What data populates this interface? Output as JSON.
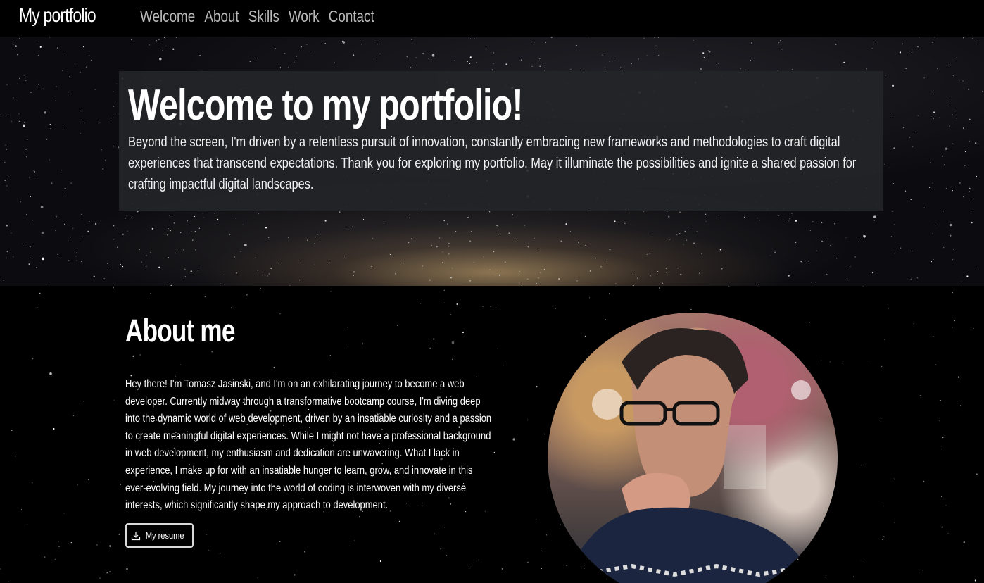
{
  "navbar": {
    "brand": "My portfolio",
    "links": [
      "Welcome",
      "About",
      "Skills",
      "Work",
      "Contact"
    ]
  },
  "hero": {
    "title": "Welcome to my portfolio!",
    "text": "Beyond the screen, I'm driven by a relentless pursuit of innovation, constantly embracing new frameworks and methodologies to craft digital experiences that transcend expectations. Thank you for exploring my portfolio. May it illuminate the possibilities and ignite a shared passion for crafting impactful digital landscapes."
  },
  "about": {
    "title": "About me",
    "text": "Hey there! I'm Tomasz Jasinski, and I'm on an exhilarating journey to become a web developer. Currently midway through a transformative bootcamp course, I'm diving deep into the dynamic world of web development, driven by an insatiable curiosity and a passion to create meaningful digital experiences. While I might not have a professional background in web development, my enthusiasm and dedication are unwavering. What I lack in experience, I make up for with an insatiable hunger to learn, grow, and innovate in this ever-evolving field. My journey into the world of coding is interwoven with my diverse interests, which significantly shape my approach to development.",
    "resume_button": "My resume",
    "resume_icon": "download-icon",
    "photo_icon": "profile-photo"
  },
  "colors": {
    "background": "#000000",
    "hero_box": "#232528",
    "nav_link": "#b9b9b9",
    "text": "#ffffff"
  }
}
